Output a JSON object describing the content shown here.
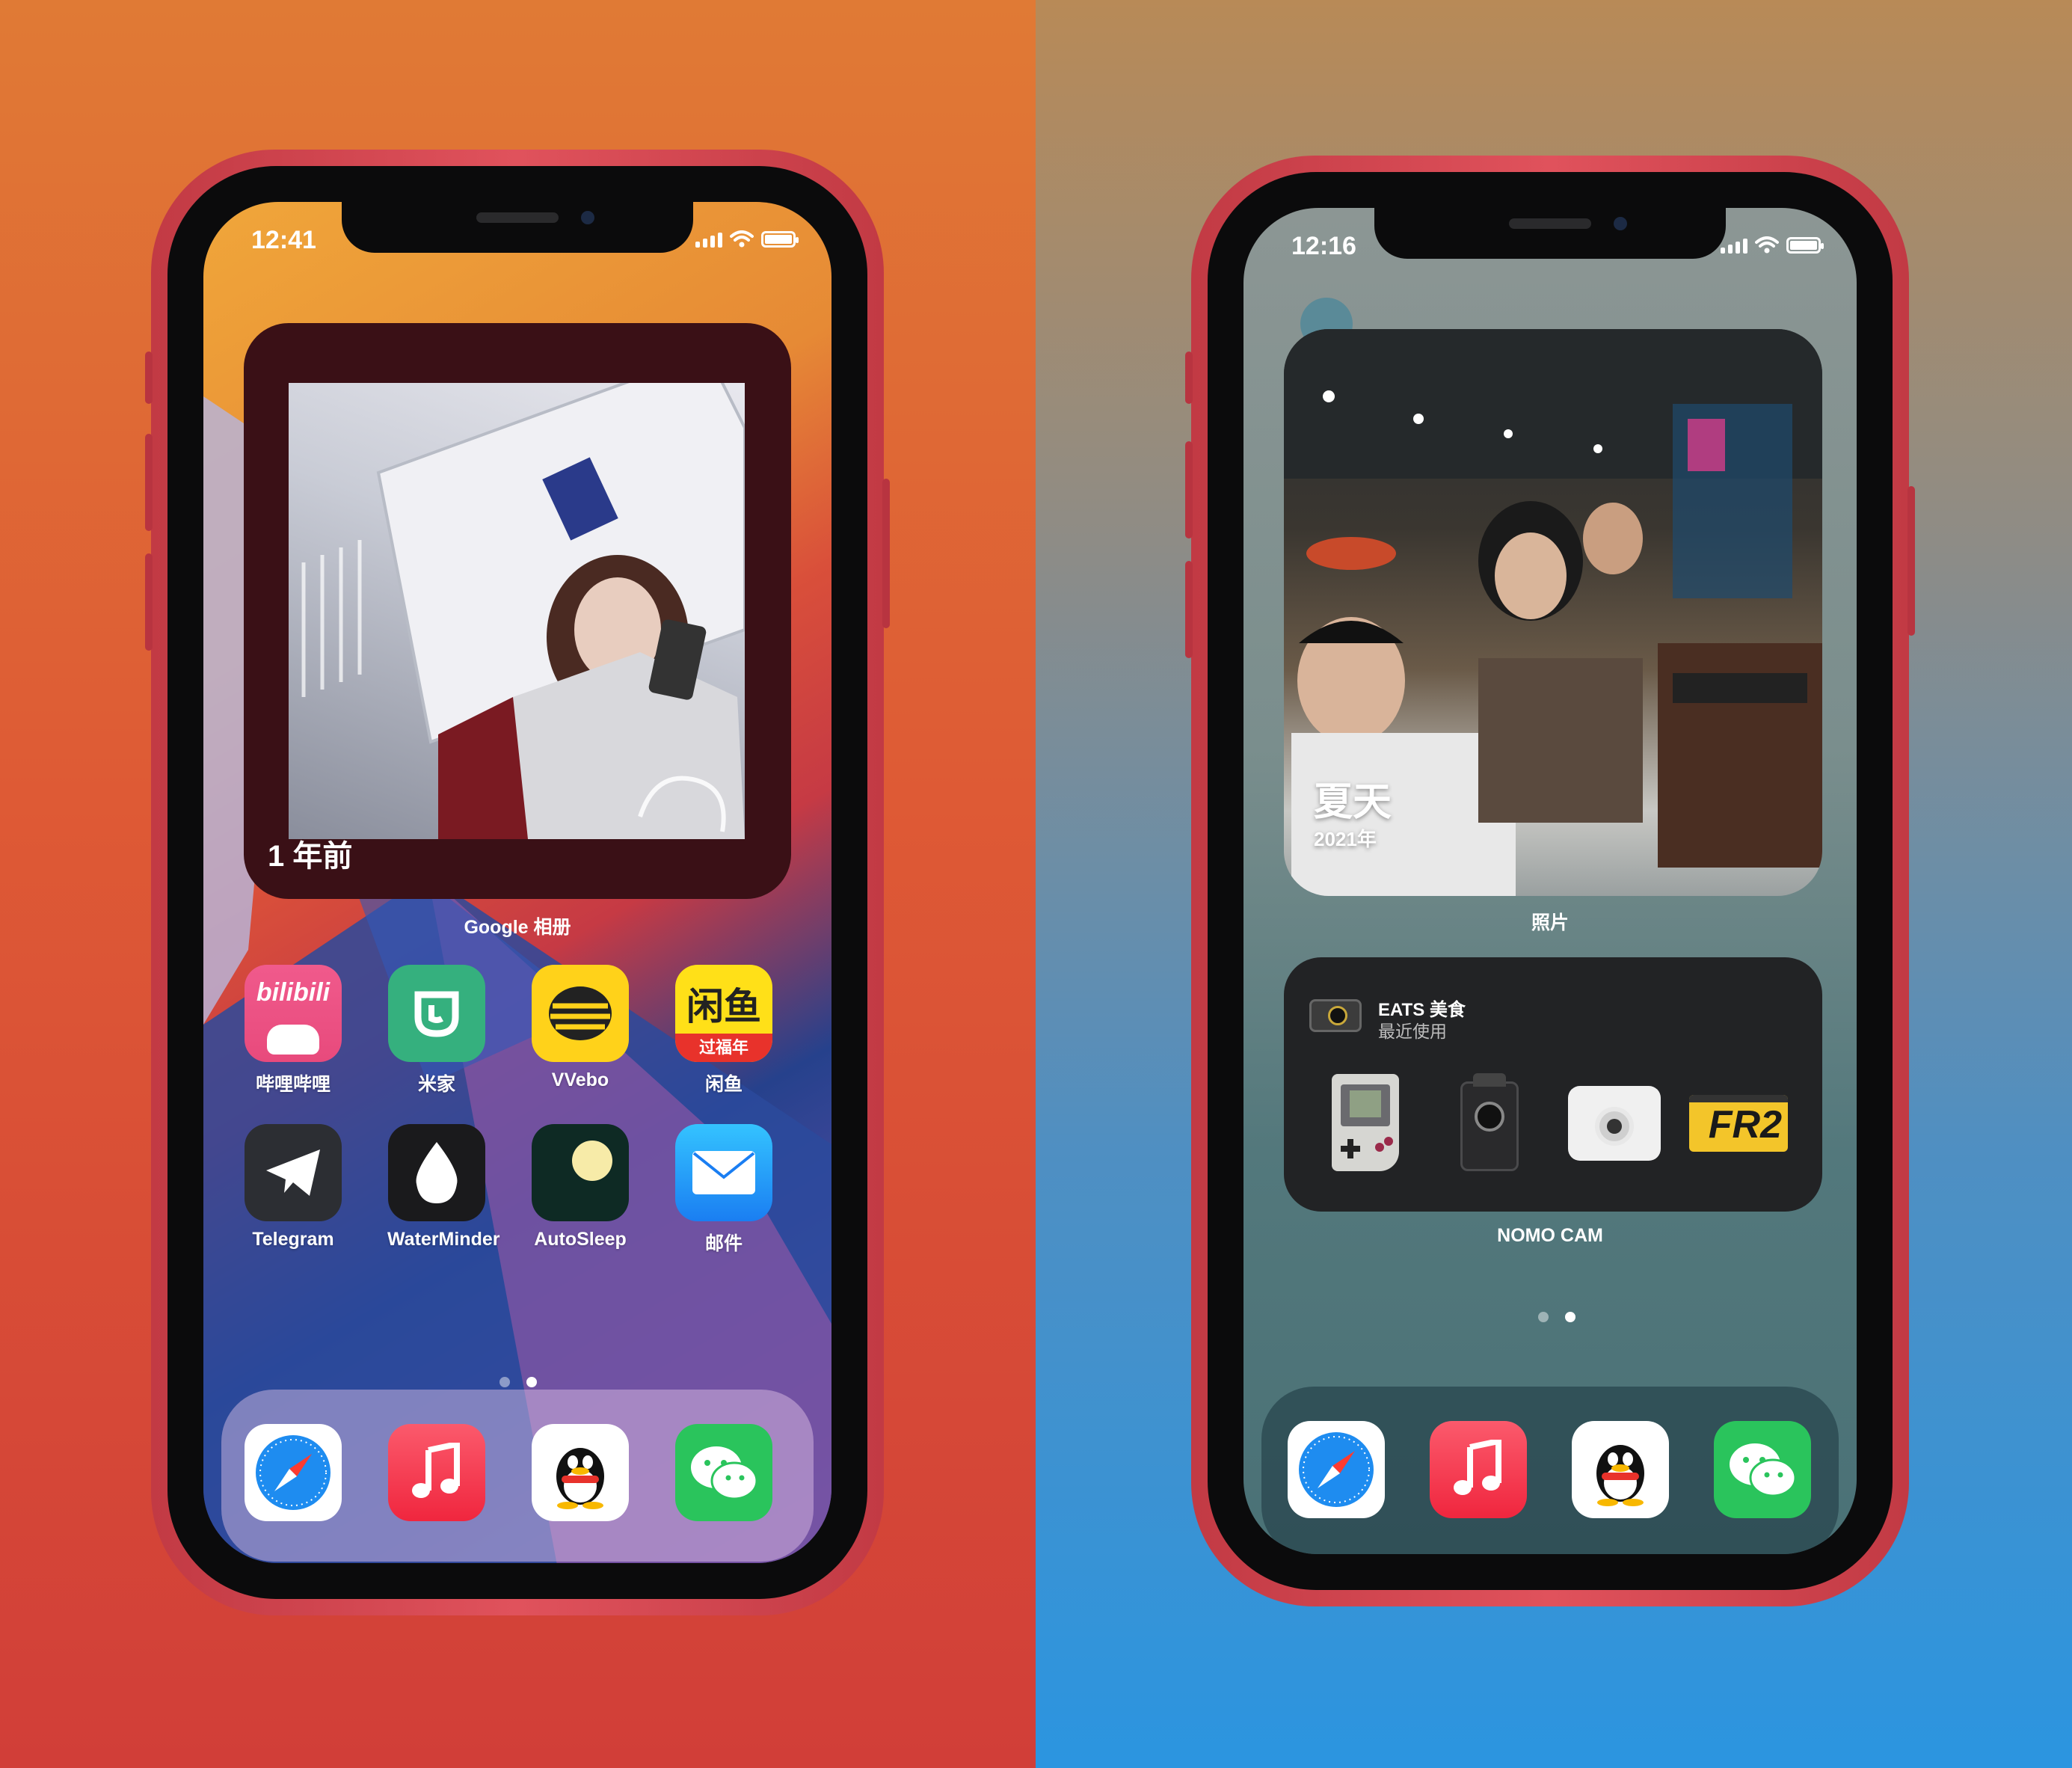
{
  "left_phone": {
    "status_time": "12:41",
    "widget": {
      "caption": "1 年前",
      "label": "Google 相册"
    },
    "apps_row1": [
      {
        "label": "哔哩哔哩",
        "icon": "bilibili-icon",
        "logo": "bilibili",
        "sub": ""
      },
      {
        "label": "米家",
        "icon": "mijia-icon",
        "logo": "",
        "sub": ""
      },
      {
        "label": "VVebo",
        "icon": "vvebo-icon",
        "logo": "",
        "sub": ""
      },
      {
        "label": "闲鱼",
        "icon": "xianyu-icon",
        "logo": "闲鱼",
        "sub": "过福年"
      }
    ],
    "apps_row2": [
      {
        "label": "Telegram",
        "icon": "telegram-icon"
      },
      {
        "label": "WaterMinder",
        "icon": "waterminder-icon"
      },
      {
        "label": "AutoSleep",
        "icon": "autosleep-icon"
      },
      {
        "label": "邮件",
        "icon": "mail-icon"
      }
    ],
    "page_dots": 2,
    "active_page": 2
  },
  "right_phone": {
    "status_time": "12:16",
    "widget": {
      "caption": "夏天",
      "subcaption": "2021年",
      "label": "照片"
    },
    "nomo_widget": {
      "title": "EATS 美食",
      "subtitle": "最近使用",
      "label": "NOMO CAM",
      "cameras": [
        {
          "name": "gameboy-camera-icon"
        },
        {
          "name": "box-camera-icon"
        },
        {
          "name": "instant-camera-icon"
        },
        {
          "name": "fr2-camera-icon",
          "text": "FR2"
        }
      ]
    },
    "page_dots": 2,
    "active_page": 2
  },
  "dock": [
    {
      "name": "safari-icon"
    },
    {
      "name": "music-icon"
    },
    {
      "name": "qq-icon"
    },
    {
      "name": "wechat-icon"
    }
  ],
  "colors": {
    "phone_frame": "#d34a55",
    "left_bg": "#de5a35",
    "right_bg_top": "#b88a57",
    "right_bg_bottom": "#2b95e0"
  }
}
